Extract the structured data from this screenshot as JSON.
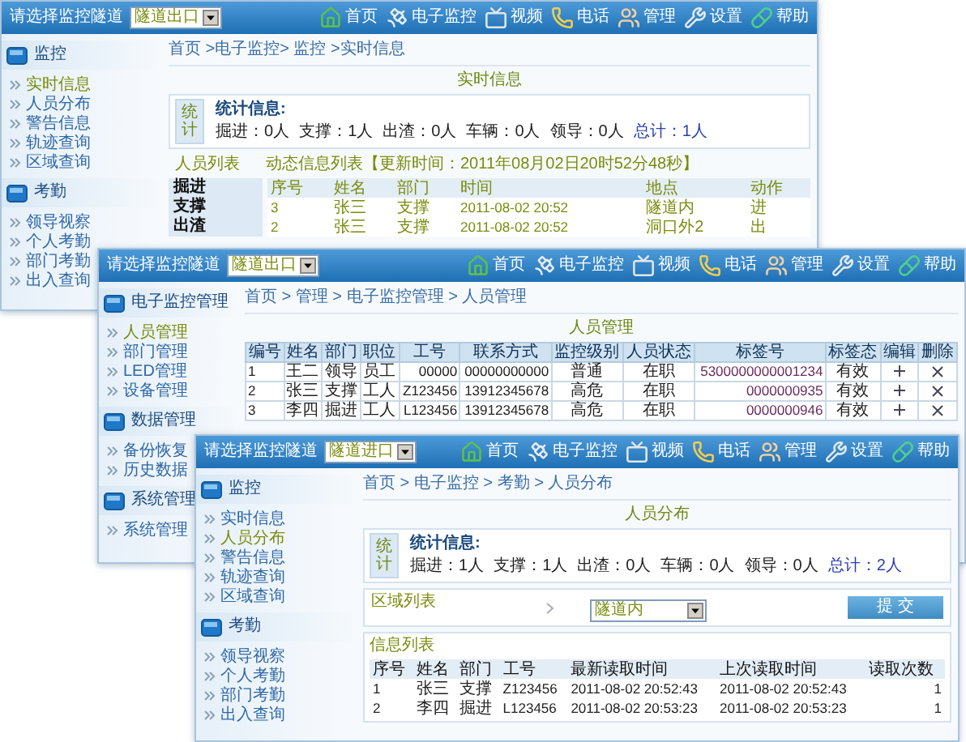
{
  "windows": [
    {
      "tunnel_select": {
        "label": "请选择监控隧道",
        "value": "隧道出口"
      },
      "nav": [
        "首页",
        "电子监控",
        "视频",
        "电话",
        "管理",
        "设置",
        "帮助"
      ],
      "sidebar": [
        {
          "title": "监控",
          "items": [
            {
              "label": "实时信息",
              "selected": true
            },
            {
              "label": "人员分布",
              "selected": false
            },
            {
              "label": "警告信息",
              "selected": false
            },
            {
              "label": "轨迹查询",
              "selected": false
            },
            {
              "label": "区域查询",
              "selected": false
            }
          ]
        },
        {
          "title": "考勤",
          "items": [
            {
              "label": "领导视察",
              "selected": false
            },
            {
              "label": "个人考勤",
              "selected": false
            },
            {
              "label": "部门考勤",
              "selected": false
            },
            {
              "label": "出入查询",
              "selected": false
            }
          ]
        }
      ],
      "breadcrumb": "首页 >电子监控> 监控 >实时信息",
      "title": "实时信息",
      "panels": [
        {
          "kind": "stats",
          "badge": "统计",
          "heading": "统计信息:",
          "counts": [
            {
              "text": "掘进：0人",
              "kind": "count"
            },
            {
              "text": "支撑：1人",
              "kind": "count"
            },
            {
              "text": "出渣：0人",
              "kind": "count"
            },
            {
              "text": "车辆：0人",
              "kind": "count"
            },
            {
              "text": "领导：0人",
              "kind": "count"
            },
            {
              "text": "总计：1人",
              "kind": "total"
            }
          ]
        },
        {
          "kind": "list_caption",
          "label": "人员列表",
          "note": "动态信息列表【更新时间：2011年08月02日20时52分48秒】"
        },
        {
          "kind": "live_table",
          "categories": [
            "掘进",
            "支撑",
            "出渣"
          ],
          "columns": [
            "序号",
            "姓名",
            "部门",
            "时间",
            "地点",
            "动作"
          ],
          "rows": [
            [
              "3",
              "张三",
              "支撑",
              "2011-08-02 20:52",
              "隧道内",
              "进"
            ],
            [
              "2",
              "张三",
              "支撑",
              "2011-08-02 20:52",
              "洞口外2",
              "出"
            ]
          ]
        }
      ]
    },
    {
      "tunnel_select": {
        "label": "请选择监控隧道",
        "value": "隧道出口"
      },
      "nav": [
        "首页",
        "电子监控",
        "视频",
        "电话",
        "管理",
        "设置",
        "帮助"
      ],
      "sidebar": [
        {
          "title": "电子监控管理",
          "items": [
            {
              "label": "人员管理",
              "selected": true
            },
            {
              "label": "部门管理",
              "selected": false
            },
            {
              "label": "LED管理",
              "selected": false
            },
            {
              "label": "设备管理",
              "selected": false
            }
          ]
        },
        {
          "title": "数据管理",
          "items": [
            {
              "label": "备份恢复",
              "selected": false
            },
            {
              "label": "历史数据",
              "selected": false
            }
          ]
        },
        {
          "title": "系统管理",
          "items": [
            {
              "label": "系统管理",
              "selected": false
            }
          ]
        }
      ],
      "breadcrumb": "首页 > 管理 > 电子监控管理 > 人员管理",
      "title": "人员管理",
      "panels": [
        {
          "kind": "grid_table",
          "columns": [
            "编号",
            "姓名",
            "部门",
            "职位",
            "工号",
            "联系方式",
            "监控级别",
            "人员状态",
            "标签号",
            "标签态",
            "编辑",
            "删除"
          ],
          "rows": [
            [
              "1",
              "王二",
              "领导",
              "员工",
              "00000",
              "00000000000",
              "普通",
              "在职",
              "5300000000001234",
              "有效"
            ],
            [
              "2",
              "张三",
              "支撑",
              "工人",
              "Z123456",
              "13912345678",
              "高危",
              "在职",
              "0000000935",
              "有效"
            ],
            [
              "3",
              "李四",
              "掘进",
              "工人",
              "L123456",
              "13912345678",
              "高危",
              "在职",
              "0000000946",
              "有效"
            ]
          ]
        }
      ]
    },
    {
      "tunnel_select": {
        "label": "请选择监控隧道",
        "value": "隧道进口"
      },
      "nav": [
        "首页",
        "电子监控",
        "视频",
        "电话",
        "管理",
        "设置",
        "帮助"
      ],
      "sidebar": [
        {
          "title": "监控",
          "items": [
            {
              "label": "实时信息",
              "selected": false
            },
            {
              "label": "人员分布",
              "selected": true
            },
            {
              "label": "警告信息",
              "selected": false
            },
            {
              "label": "轨迹查询",
              "selected": false
            },
            {
              "label": "区域查询",
              "selected": false
            }
          ]
        },
        {
          "title": "考勤",
          "items": [
            {
              "label": "领导视察",
              "selected": false
            },
            {
              "label": "个人考勤",
              "selected": false
            },
            {
              "label": "部门考勤",
              "selected": false
            },
            {
              "label": "出入查询",
              "selected": false
            }
          ]
        }
      ],
      "breadcrumb": "首页 > 电子监控 > 考勤 > 人员分布",
      "title": "人员分布",
      "panels": [
        {
          "kind": "stats",
          "badge": "统计",
          "heading": "统计信息:",
          "counts": [
            {
              "text": "掘进：1人",
              "kind": "count"
            },
            {
              "text": "支撑：1人",
              "kind": "count"
            },
            {
              "text": "出渣：0人",
              "kind": "count"
            },
            {
              "text": "车辆：0人",
              "kind": "count"
            },
            {
              "text": "领导：0人",
              "kind": "count"
            },
            {
              "text": "总计：2人",
              "kind": "total"
            }
          ]
        },
        {
          "kind": "region_filter",
          "label": "区域列表",
          "select": "隧道内",
          "button": "提 交"
        },
        {
          "kind": "info_table",
          "caption": "信息列表",
          "columns": [
            "序号",
            "姓名",
            "部门",
            "工号",
            "最新读取时间",
            "上次读取时间",
            "读取次数"
          ],
          "rows": [
            [
              "1",
              "张三",
              "支撑",
              "Z123456",
              "2011-08-02 20:52:43",
              "2011-08-02 20:52:43",
              "1"
            ],
            [
              "2",
              "李四",
              "掘进",
              "L123456",
              "2011-08-02 20:53:23",
              "2011-08-02 20:53:23",
              "1"
            ]
          ]
        }
      ]
    }
  ]
}
